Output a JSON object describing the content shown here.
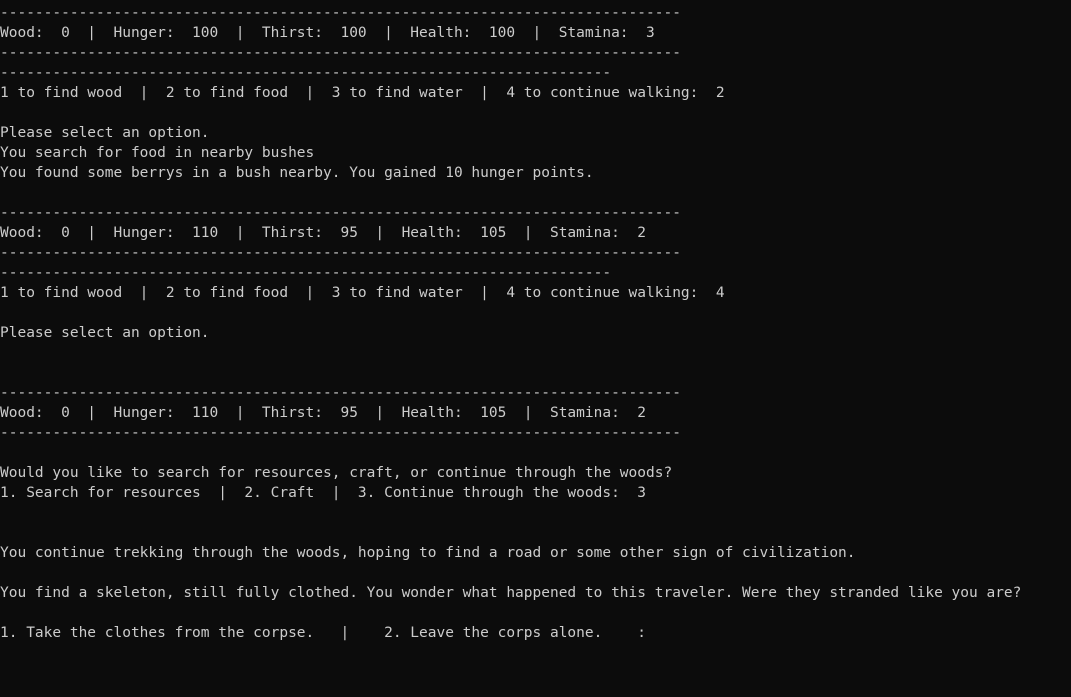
{
  "colors": {
    "background": "#0c0c0c",
    "foreground": "#cccccc"
  },
  "lines": [
    "------------------------------------------------------------------------------",
    "Wood:  0  |  Hunger:  100  |  Thirst:  100  |  Health:  100  |  Stamina:  3",
    "------------------------------------------------------------------------------",
    "----------------------------------------------------------------------",
    "1 to find wood  |  2 to find food  |  3 to find water  |  4 to continue walking:  2",
    "",
    "Please select an option.",
    "You search for food in nearby bushes",
    "You found some berrys in a bush nearby. You gained 10 hunger points.",
    "",
    "------------------------------------------------------------------------------",
    "Wood:  0  |  Hunger:  110  |  Thirst:  95  |  Health:  105  |  Stamina:  2",
    "------------------------------------------------------------------------------",
    "----------------------------------------------------------------------",
    "1 to find wood  |  2 to find food  |  3 to find water  |  4 to continue walking:  4",
    "",
    "Please select an option.",
    "",
    "",
    "------------------------------------------------------------------------------",
    "Wood:  0  |  Hunger:  110  |  Thirst:  95  |  Health:  105  |  Stamina:  2",
    "------------------------------------------------------------------------------",
    "",
    "Would you like to search for resources, craft, or continue through the woods?",
    "1. Search for resources  |  2. Craft  |  3. Continue through the woods:  3",
    "",
    "",
    "You continue trekking through the woods, hoping to find a road or some other sign of civilization.",
    "",
    "You find a skeleton, still fully clothed. You wonder what happened to this traveler. Were they stranded like you are?",
    "",
    "1. Take the clothes from the corpse.   |    2. Leave the corps alone.    :"
  ]
}
